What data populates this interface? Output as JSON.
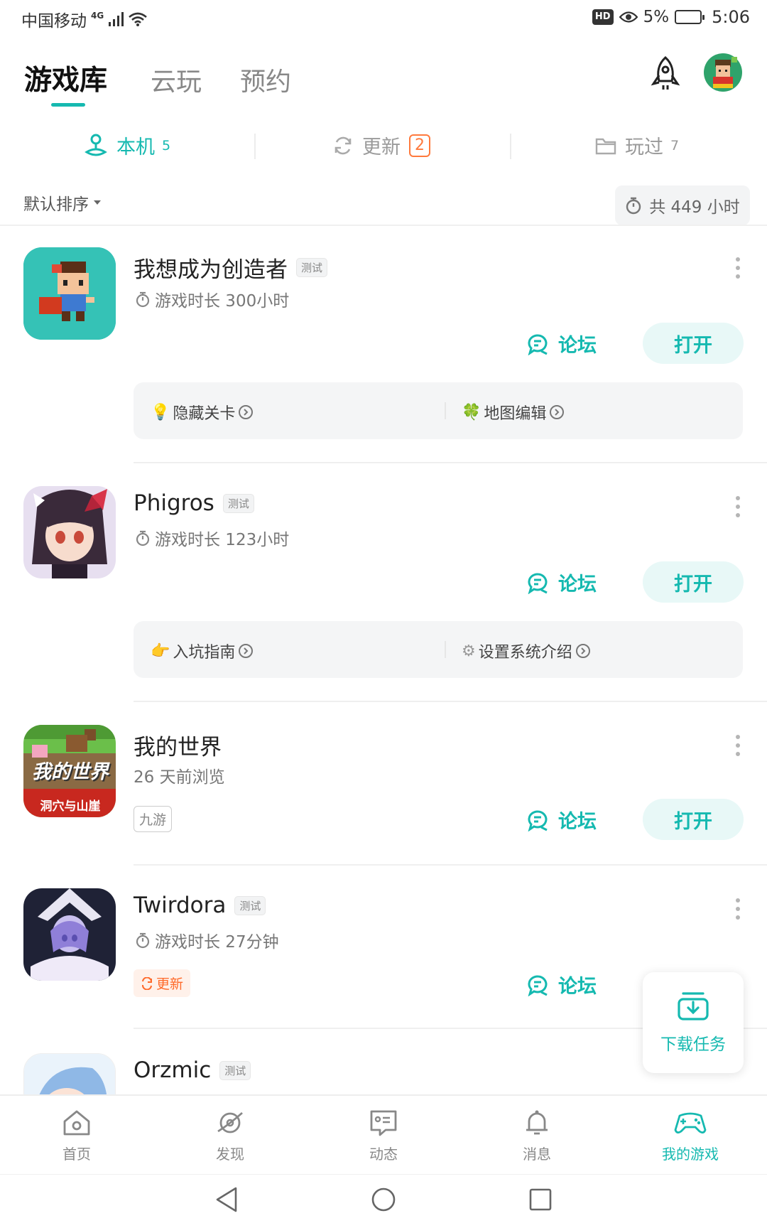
{
  "status_bar": {
    "carrier": "中国移动",
    "network": "4G",
    "hd": "HD",
    "battery": "5%",
    "time": "5:06"
  },
  "header": {
    "tabs": [
      {
        "label": "游戏库"
      },
      {
        "label": "云玩"
      },
      {
        "label": "预约"
      }
    ],
    "active_tab": 0
  },
  "sub_tabs": [
    {
      "label": "本机",
      "count": "5"
    },
    {
      "label": "更新",
      "badge": "2"
    },
    {
      "label": "玩过",
      "count": "7"
    }
  ],
  "sort": {
    "label": "默认排序"
  },
  "total_time": {
    "label": "共 449 小时"
  },
  "games": [
    {
      "title": "我想成为创造者",
      "tag": "测试",
      "subtitle": "游戏时长 300小时",
      "forum": "论坛",
      "open": "打开",
      "tips": [
        {
          "emoji": "💡",
          "label": "隐藏关卡"
        },
        {
          "emoji": "🍀",
          "label": "地图编辑"
        }
      ]
    },
    {
      "title": "Phigros",
      "tag": "测试",
      "subtitle": "游戏时长 123小时",
      "forum": "论坛",
      "open": "打开",
      "tips": [
        {
          "emoji": "👉",
          "label": "入坑指南"
        },
        {
          "emoji": "⚙",
          "label": "设置系统介绍"
        }
      ]
    },
    {
      "title": "我的世界",
      "subtitle": "26 天前浏览",
      "chip": "九游",
      "forum": "论坛",
      "open": "打开",
      "icon_text_top": "我的世界",
      "icon_text_bottom": "洞穴与山崖"
    },
    {
      "title": "Twirdora",
      "tag": "测试",
      "subtitle": "游戏时长 27分钟",
      "update_chip": "更新",
      "forum": "论坛"
    },
    {
      "title": "Orzmic",
      "tag": "测试"
    }
  ],
  "download_float": {
    "label": "下载任务"
  },
  "bottom_nav": [
    {
      "label": "首页",
      "icon": "home-icon"
    },
    {
      "label": "发现",
      "icon": "planet-icon"
    },
    {
      "label": "动态",
      "icon": "chat-list-icon"
    },
    {
      "label": "消息",
      "icon": "bell-icon"
    },
    {
      "label": "我的游戏",
      "icon": "gamepad-icon"
    }
  ],
  "active_nav": 4,
  "colors": {
    "accent": "#15b9b0",
    "update": "#ff7a3d"
  }
}
